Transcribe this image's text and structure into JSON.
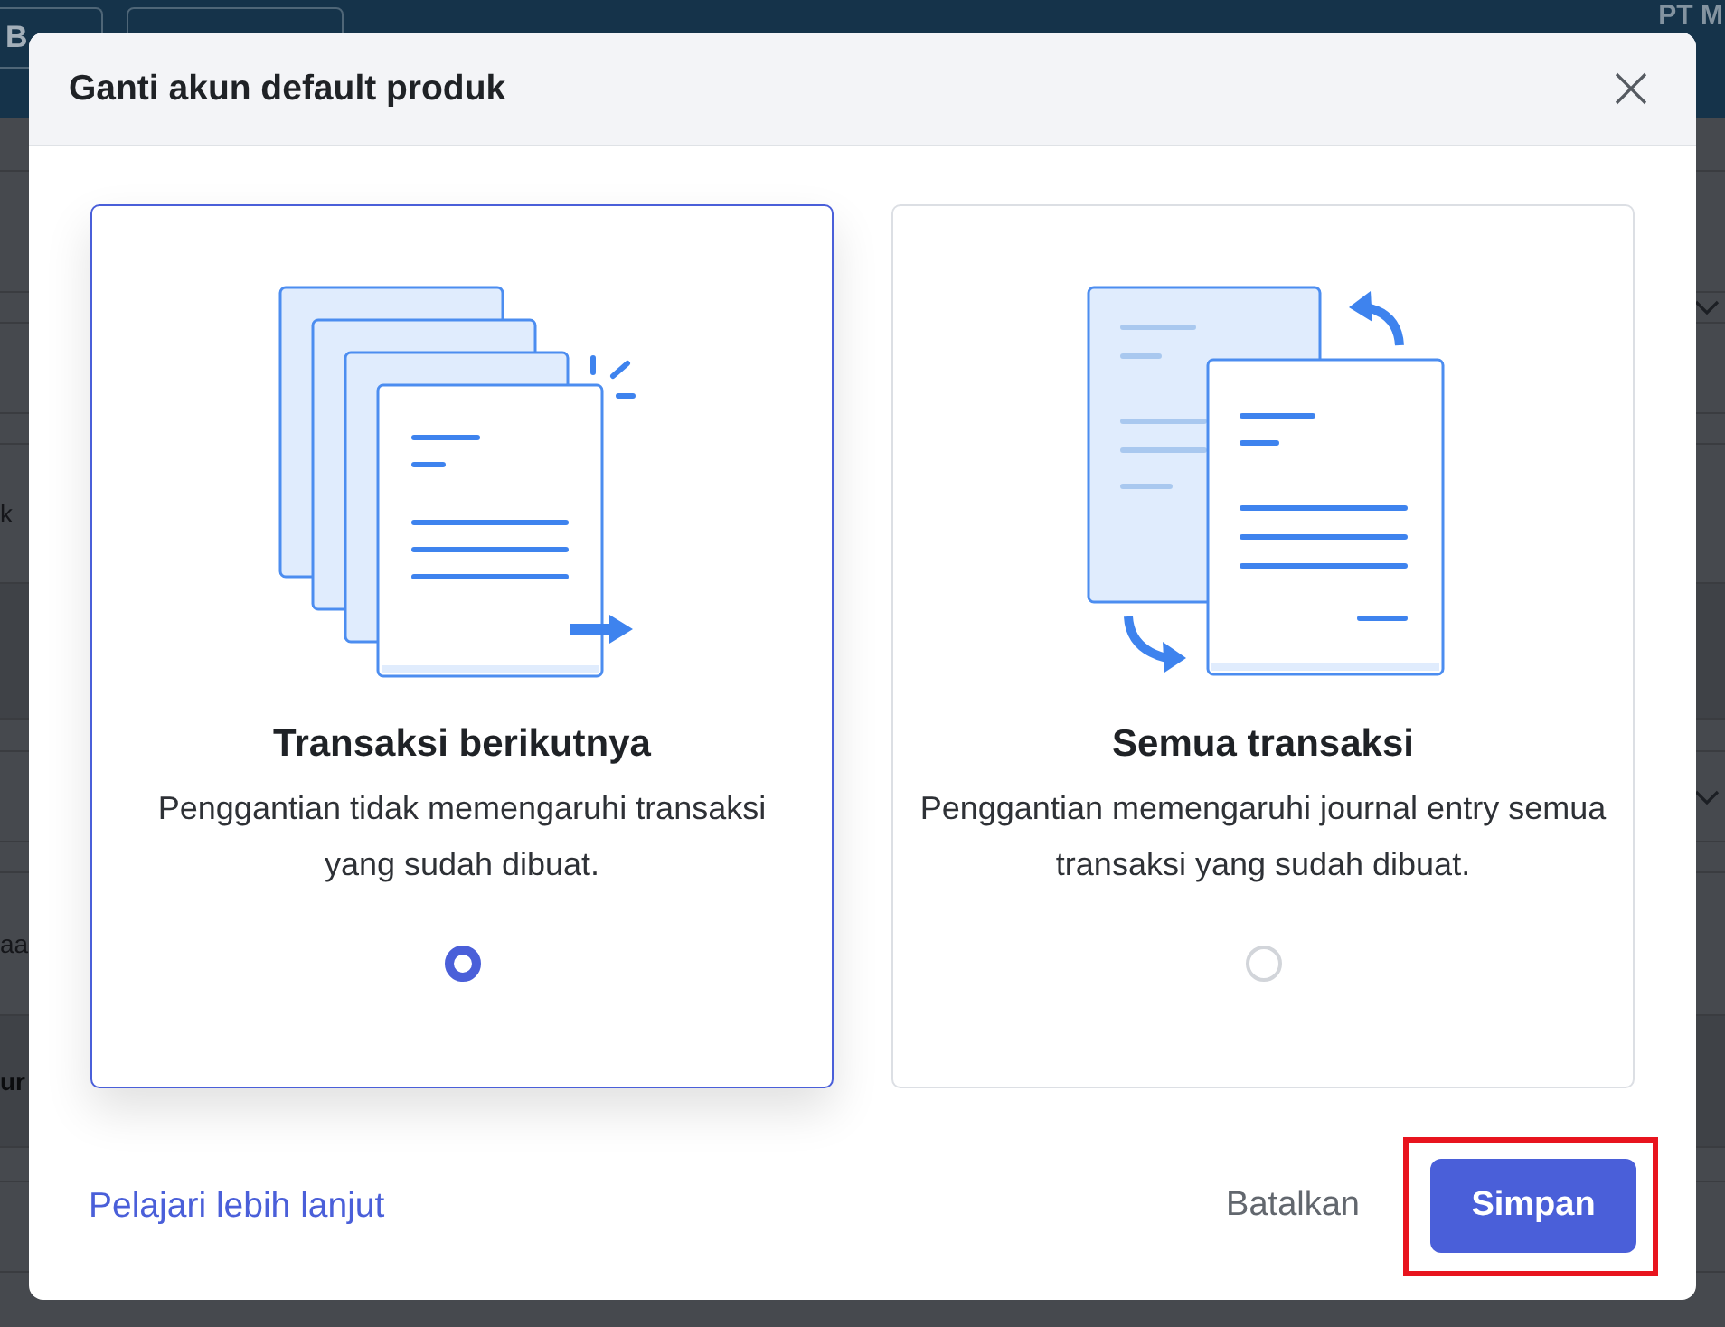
{
  "background": {
    "top_button": "B",
    "company": "PT M",
    "row_fragments": [
      {
        "text": "k",
        "bold": false
      },
      {
        "text": "aa",
        "bold": false
      },
      {
        "text": "ur",
        "bold": true
      }
    ]
  },
  "modal": {
    "title": "Ganti akun default produk",
    "options": [
      {
        "kind": "next",
        "title": "Transaksi berikutnya",
        "description": "Penggantian tidak memengaruhi transaksi yang sudah dibuat.",
        "selected": true
      },
      {
        "kind": "all",
        "title": "Semua transaksi",
        "description": "Penggantian memengaruhi journal entry semua transaksi yang sudah dibuat.",
        "selected": false
      }
    ],
    "learn_more": "Pelajari lebih lanjut",
    "cancel": "Batalkan",
    "save": {
      "label": "Simpan",
      "highlighted": true
    }
  }
}
